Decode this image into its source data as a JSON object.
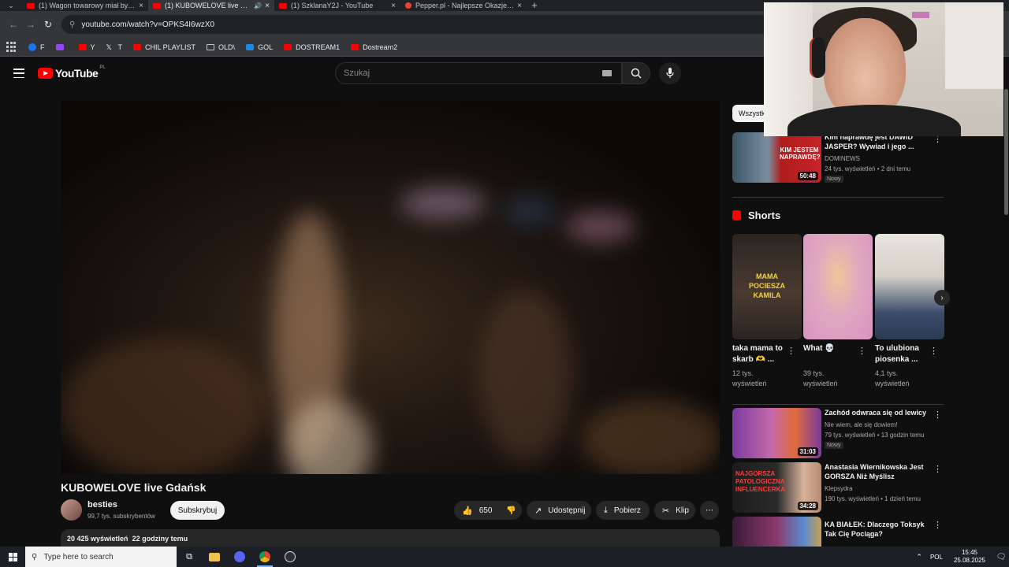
{
  "browser": {
    "tabs": [
      {
        "label": "(1) Wagon towarowy miał być p",
        "active": false,
        "icon": "youtube-icon"
      },
      {
        "label": "(1) KUBOWELOVE live Gdań",
        "active": true,
        "icon": "youtube-icon"
      },
      {
        "label": "(1) SzklanaY2J - YouTube",
        "active": false,
        "icon": "youtube-icon"
      },
      {
        "label": "Pepper.pl - Najlepsze Okazje, R",
        "active": false,
        "icon": "pepper-icon"
      }
    ],
    "url": "youtube.com/watch?v=OPKS4I6wzX0",
    "bookmarks": [
      {
        "label": "F",
        "icon": "facebook-icon"
      },
      {
        "label": "",
        "icon": "twitch-icon"
      },
      {
        "label": "Y",
        "icon": "youtube-icon"
      },
      {
        "label": "T",
        "icon": "x-icon"
      },
      {
        "label": "CHIL PLAYLIST",
        "icon": "youtube-icon"
      },
      {
        "label": "OLD\\",
        "icon": "folder-icon"
      },
      {
        "label": "GOL",
        "icon": "gol-icon"
      },
      {
        "label": "DOSTREAM1",
        "icon": "youtube-icon"
      },
      {
        "label": "Dostream2",
        "icon": "youtube-icon"
      }
    ]
  },
  "youtube": {
    "logo_text": "YouTube",
    "region": "PL",
    "search_placeholder": "Szukaj"
  },
  "video": {
    "title": "KUBOWELOVE live Gdańsk",
    "channel": "besties",
    "subscribers": "99,7 tys. subskrybentów",
    "subscribe_label": "Subskrybuj",
    "likes": "650",
    "share_label": "Udostępnij",
    "download_label": "Pobierz",
    "clip_label": "Klip",
    "views": "20 425 wyświetleń",
    "age": "22 godziny temu"
  },
  "sidebar": {
    "chip": "Wszystki",
    "recommended_top": {
      "title": "Kim naprawdę jest DAWID JASPER? Wywiad i jego ...",
      "channel": "DOMINEWS",
      "meta": "24 tys. wyświetleń • 2 dni temu",
      "badge": "Nowy",
      "duration": "50:48",
      "thumb_text": "KIM JESTEM NAPRAWDĘ?"
    },
    "shorts_title": "Shorts",
    "shorts": [
      {
        "title": "taka mama to skarb 🫶 ...",
        "views": "12 tys. wyświetleń",
        "thumb_text": "MAMA POCIESZA KAMILA"
      },
      {
        "title": "What 💀",
        "views": "39 tys. wyświetleń",
        "thumb_text": ""
      },
      {
        "title": "To ulubiona piosenka ...",
        "views": "4,1 tys. wyświetleń",
        "thumb_text": ""
      }
    ],
    "recommended": [
      {
        "title": "Zachód odwraca się od lewicy",
        "channel": "Nie wiem, ale się dowiem!",
        "meta": "79 tys. wyświetleń • 13 godzin temu",
        "badge": "Nowy",
        "duration": "31:03"
      },
      {
        "title": "Anastasia Wiernikowska Jest GORSZA Niż Myślisz",
        "channel": "Klepsydra",
        "meta": "190 tys. wyświetleń • 1 dzień temu",
        "badge": "",
        "duration": "34:28",
        "thumb_text": "NAJGORSZA PATOLOGICZNA INFLUENCERKA"
      },
      {
        "title": "KA BIAŁEK: Dlaczego Toksyk Tak Cię Pociąga?",
        "channel": "",
        "meta": "",
        "badge": "",
        "duration": ""
      }
    ]
  },
  "taskbar": {
    "search_placeholder": "Type here to search",
    "lang": "POL",
    "time": "15:45",
    "date": "25.08.2025"
  },
  "colors": {
    "accent_red": "#ff0000",
    "bg": "#0f0f0f",
    "surface": "#272727"
  }
}
